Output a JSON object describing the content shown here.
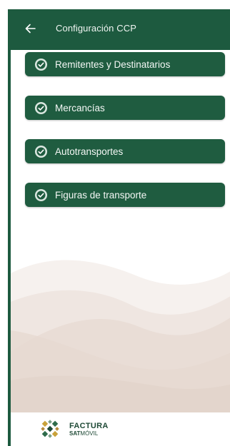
{
  "header": {
    "back_icon": "arrow-left-icon",
    "title": "Configuración CCP"
  },
  "menu": {
    "items": [
      {
        "label": "Remitentes y Destinatarios",
        "icon": "check-circle-icon"
      },
      {
        "label": "Mercancías",
        "icon": "check-circle-icon"
      },
      {
        "label": "Autotransportes",
        "icon": "check-circle-icon"
      },
      {
        "label": "Figuras de transporte",
        "icon": "check-circle-icon"
      }
    ]
  },
  "footer": {
    "logo_line1": "FACTURA",
    "logo_line2_bold": "SAT",
    "logo_line2_rest": "MÓVIL"
  },
  "colors": {
    "primary": "#1d5a3f",
    "button": "#1f5c40",
    "wave": "#e9ddd6"
  }
}
